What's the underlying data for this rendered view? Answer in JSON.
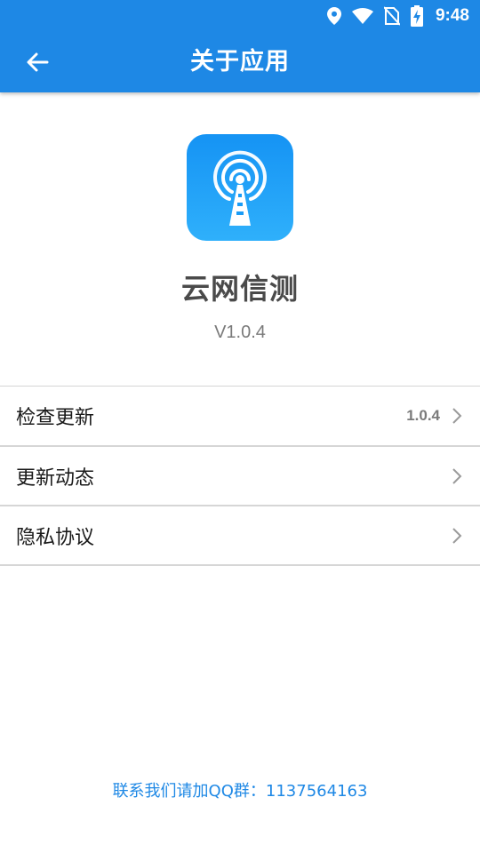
{
  "status_bar": {
    "time": "9:48",
    "icons": [
      "location-icon",
      "wifi-icon",
      "no-sim-icon",
      "battery-charging-icon"
    ]
  },
  "toolbar": {
    "title": "关于应用",
    "back_icon": "arrow-left-icon"
  },
  "app": {
    "icon": "signal-tower-icon",
    "name": "云网信测",
    "version": "V1.0.4"
  },
  "menu": {
    "items": [
      {
        "label": "检查更新",
        "value": "1.0.4"
      },
      {
        "label": "更新动态",
        "value": ""
      },
      {
        "label": "隐私协议",
        "value": ""
      }
    ]
  },
  "contact": {
    "text": "联系我们请加QQ群：1137564163"
  },
  "colors": {
    "primary": "#1e88e5",
    "logo_gradient_top": "#1593f4",
    "logo_gradient_bottom": "#2fb0fb"
  }
}
